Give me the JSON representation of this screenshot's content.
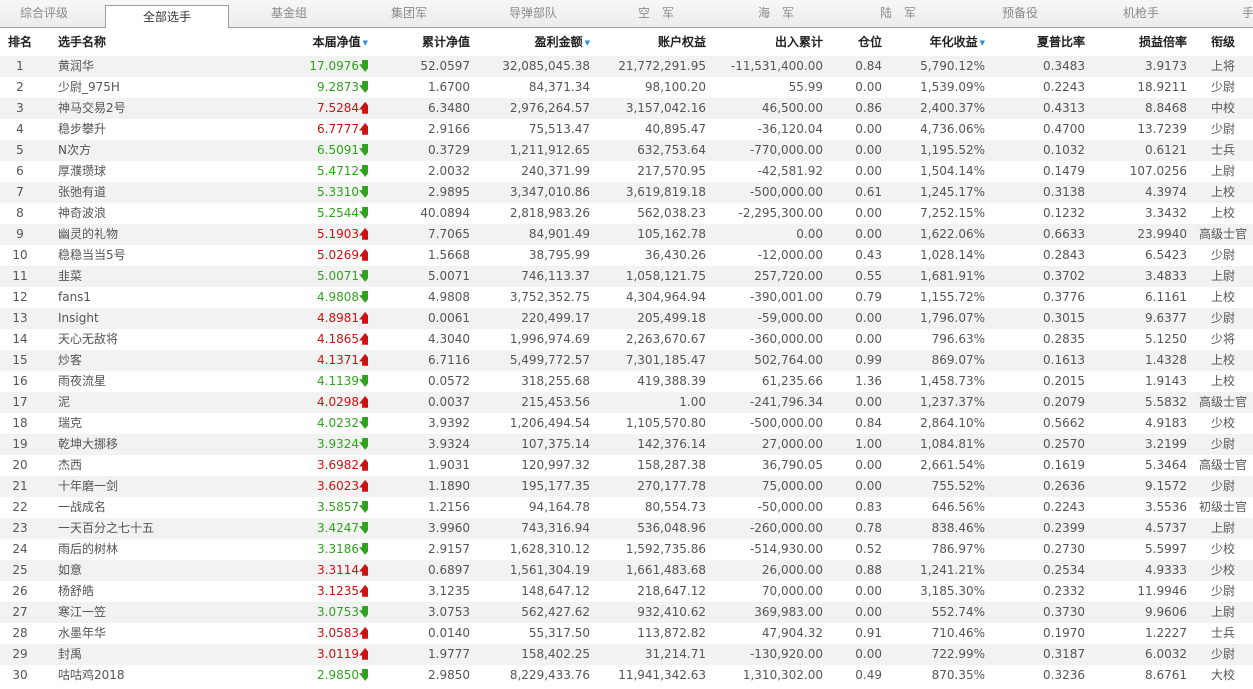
{
  "tabs": [
    {
      "label": "综合评级",
      "active": false
    },
    {
      "label": "全部选手",
      "active": true
    },
    {
      "label": "基金组",
      "active": false
    },
    {
      "label": "集团军",
      "active": false
    },
    {
      "label": "导弹部队",
      "active": false
    },
    {
      "label": "空　军",
      "active": false
    },
    {
      "label": "海　军",
      "active": false
    },
    {
      "label": "陆　军",
      "active": false
    },
    {
      "label": "预备役",
      "active": false
    },
    {
      "label": "机枪手",
      "active": false
    },
    {
      "label": "手",
      "active": false
    }
  ],
  "columns": [
    {
      "key": "rank",
      "label": "排名",
      "sorted": false
    },
    {
      "key": "name",
      "label": "选手名称",
      "sorted": false
    },
    {
      "key": "nav",
      "label": "本届净值",
      "sorted": true
    },
    {
      "key": "cum_nav",
      "label": "累计净值",
      "sorted": false
    },
    {
      "key": "profit",
      "label": "盈利金额",
      "sorted": true
    },
    {
      "key": "equity",
      "label": "账户权益",
      "sorted": false
    },
    {
      "key": "flow",
      "label": "出入累计",
      "sorted": false
    },
    {
      "key": "position",
      "label": "仓位",
      "sorted": false
    },
    {
      "key": "annual",
      "label": "年化收益",
      "sorted": true
    },
    {
      "key": "sharpe",
      "label": "夏普比率",
      "sorted": false
    },
    {
      "key": "pl_ratio",
      "label": "损益倍率",
      "sorted": false
    },
    {
      "key": "grade",
      "label": "衔级",
      "sorted": false
    }
  ],
  "rows": [
    {
      "rank": "1",
      "name": "黄润华",
      "nav": "17.0976",
      "trend": "down",
      "cum_nav": "52.0597",
      "profit": "32,085,045.38",
      "equity": "21,772,291.95",
      "flow": "-11,531,400.00",
      "position": "0.84",
      "annual": "5,790.12%",
      "sharpe": "0.3483",
      "pl_ratio": "3.9173",
      "grade": "上将"
    },
    {
      "rank": "2",
      "name": "少尉_975H",
      "nav": "9.2873",
      "trend": "down",
      "cum_nav": "1.6700",
      "profit": "84,371.34",
      "equity": "98,100.20",
      "flow": "55.99",
      "position": "0.00",
      "annual": "1,539.09%",
      "sharpe": "0.2243",
      "pl_ratio": "18.9211",
      "grade": "少尉"
    },
    {
      "rank": "3",
      "name": "神马交易2号",
      "nav": "7.5284",
      "trend": "up",
      "cum_nav": "6.3480",
      "profit": "2,976,264.57",
      "equity": "3,157,042.16",
      "flow": "46,500.00",
      "position": "0.86",
      "annual": "2,400.37%",
      "sharpe": "0.4313",
      "pl_ratio": "8.8468",
      "grade": "中校"
    },
    {
      "rank": "4",
      "name": "稳步攀升",
      "nav": "6.7777",
      "trend": "up",
      "cum_nav": "2.9166",
      "profit": "75,513.47",
      "equity": "40,895.47",
      "flow": "-36,120.04",
      "position": "0.00",
      "annual": "4,736.06%",
      "sharpe": "0.4700",
      "pl_ratio": "13.7239",
      "grade": "少尉"
    },
    {
      "rank": "5",
      "name": "N次方",
      "nav": "6.5091",
      "trend": "down",
      "cum_nav": "0.3729",
      "profit": "1,211,912.65",
      "equity": "632,753.64",
      "flow": "-770,000.00",
      "position": "0.00",
      "annual": "1,195.52%",
      "sharpe": "0.1032",
      "pl_ratio": "0.6121",
      "grade": "士兵"
    },
    {
      "rank": "6",
      "name": "厚濮瓒球",
      "nav": "5.4712",
      "trend": "down",
      "cum_nav": "2.0032",
      "profit": "240,371.99",
      "equity": "217,570.95",
      "flow": "-42,581.92",
      "position": "0.00",
      "annual": "1,504.14%",
      "sharpe": "0.1479",
      "pl_ratio": "107.0256",
      "grade": "上尉"
    },
    {
      "rank": "7",
      "name": "张弛有道",
      "nav": "5.3310",
      "trend": "down",
      "cum_nav": "2.9895",
      "profit": "3,347,010.86",
      "equity": "3,619,819.18",
      "flow": "-500,000.00",
      "position": "0.61",
      "annual": "1,245.17%",
      "sharpe": "0.3138",
      "pl_ratio": "4.3974",
      "grade": "上校"
    },
    {
      "rank": "8",
      "name": "神奇波浪",
      "nav": "5.2544",
      "trend": "down",
      "cum_nav": "40.0894",
      "profit": "2,818,983.26",
      "equity": "562,038.23",
      "flow": "-2,295,300.00",
      "position": "0.00",
      "annual": "7,252.15%",
      "sharpe": "0.1232",
      "pl_ratio": "3.3432",
      "grade": "上校"
    },
    {
      "rank": "9",
      "name": "幽灵的礼物",
      "nav": "5.1903",
      "trend": "up",
      "cum_nav": "7.7065",
      "profit": "84,901.49",
      "equity": "105,162.78",
      "flow": "0.00",
      "position": "0.00",
      "annual": "1,622.06%",
      "sharpe": "0.6633",
      "pl_ratio": "23.9940",
      "grade": "高级士官"
    },
    {
      "rank": "10",
      "name": "稳稳当当5号",
      "nav": "5.0269",
      "trend": "up",
      "cum_nav": "1.5668",
      "profit": "38,795.99",
      "equity": "36,430.26",
      "flow": "-12,000.00",
      "position": "0.43",
      "annual": "1,028.14%",
      "sharpe": "0.2843",
      "pl_ratio": "6.5423",
      "grade": "少尉"
    },
    {
      "rank": "11",
      "name": "韭菜",
      "nav": "5.0071",
      "trend": "down",
      "cum_nav": "5.0071",
      "profit": "746,113.37",
      "equity": "1,058,121.75",
      "flow": "257,720.00",
      "position": "0.55",
      "annual": "1,681.91%",
      "sharpe": "0.3702",
      "pl_ratio": "3.4833",
      "grade": "上尉"
    },
    {
      "rank": "12",
      "name": "fans1",
      "nav": "4.9808",
      "trend": "down",
      "cum_nav": "4.9808",
      "profit": "3,752,352.75",
      "equity": "4,304,964.94",
      "flow": "-390,001.00",
      "position": "0.79",
      "annual": "1,155.72%",
      "sharpe": "0.3776",
      "pl_ratio": "6.1161",
      "grade": "上校"
    },
    {
      "rank": "13",
      "name": "Insight",
      "nav": "4.8981",
      "trend": "up",
      "cum_nav": "0.0061",
      "profit": "220,499.17",
      "equity": "205,499.18",
      "flow": "-59,000.00",
      "position": "0.00",
      "annual": "1,796.07%",
      "sharpe": "0.3015",
      "pl_ratio": "9.6377",
      "grade": "少尉"
    },
    {
      "rank": "14",
      "name": "天心无敌将",
      "nav": "4.1865",
      "trend": "up",
      "cum_nav": "4.3040",
      "profit": "1,996,974.69",
      "equity": "2,263,670.67",
      "flow": "-360,000.00",
      "position": "0.00",
      "annual": "796.63%",
      "sharpe": "0.2835",
      "pl_ratio": "5.1250",
      "grade": "少将"
    },
    {
      "rank": "15",
      "name": "炒客",
      "nav": "4.1371",
      "trend": "up",
      "cum_nav": "6.7116",
      "profit": "5,499,772.57",
      "equity": "7,301,185.47",
      "flow": "502,764.00",
      "position": "0.99",
      "annual": "869.07%",
      "sharpe": "0.1613",
      "pl_ratio": "1.4328",
      "grade": "上校"
    },
    {
      "rank": "16",
      "name": "雨夜流星",
      "nav": "4.1139",
      "trend": "down",
      "cum_nav": "0.0572",
      "profit": "318,255.68",
      "equity": "419,388.39",
      "flow": "61,235.66",
      "position": "1.36",
      "annual": "1,458.73%",
      "sharpe": "0.2015",
      "pl_ratio": "1.9143",
      "grade": "上校"
    },
    {
      "rank": "17",
      "name": "泥",
      "nav": "4.0298",
      "trend": "up",
      "cum_nav": "0.0037",
      "profit": "215,453.56",
      "equity": "1.00",
      "flow": "-241,796.34",
      "position": "0.00",
      "annual": "1,237.37%",
      "sharpe": "0.2079",
      "pl_ratio": "5.5832",
      "grade": "高级士官"
    },
    {
      "rank": "18",
      "name": "瑞克",
      "nav": "4.0232",
      "trend": "down",
      "cum_nav": "3.9392",
      "profit": "1,206,494.54",
      "equity": "1,105,570.80",
      "flow": "-500,000.00",
      "position": "0.84",
      "annual": "2,864.10%",
      "sharpe": "0.5662",
      "pl_ratio": "4.9183",
      "grade": "少校"
    },
    {
      "rank": "19",
      "name": "乾坤大挪移",
      "nav": "3.9324",
      "trend": "down",
      "cum_nav": "3.9324",
      "profit": "107,375.14",
      "equity": "142,376.14",
      "flow": "27,000.00",
      "position": "1.00",
      "annual": "1,084.81%",
      "sharpe": "0.2570",
      "pl_ratio": "3.2199",
      "grade": "少尉"
    },
    {
      "rank": "20",
      "name": "杰西",
      "nav": "3.6982",
      "trend": "up",
      "cum_nav": "1.9031",
      "profit": "120,997.32",
      "equity": "158,287.38",
      "flow": "36,790.05",
      "position": "0.00",
      "annual": "2,661.54%",
      "sharpe": "0.1619",
      "pl_ratio": "5.3464",
      "grade": "高级士官"
    },
    {
      "rank": "21",
      "name": "十年磨一剑",
      "nav": "3.6023",
      "trend": "up",
      "cum_nav": "1.1890",
      "profit": "195,177.35",
      "equity": "270,177.78",
      "flow": "75,000.00",
      "position": "0.00",
      "annual": "755.52%",
      "sharpe": "0.2636",
      "pl_ratio": "9.1572",
      "grade": "少尉"
    },
    {
      "rank": "22",
      "name": "一战成名",
      "nav": "3.5857",
      "trend": "down",
      "cum_nav": "1.2156",
      "profit": "94,164.78",
      "equity": "80,554.73",
      "flow": "-50,000.00",
      "position": "0.83",
      "annual": "646.56%",
      "sharpe": "0.2243",
      "pl_ratio": "3.5536",
      "grade": "初级士官"
    },
    {
      "rank": "23",
      "name": "一天百分之七十五",
      "nav": "3.4247",
      "trend": "down",
      "cum_nav": "3.9960",
      "profit": "743,316.94",
      "equity": "536,048.96",
      "flow": "-260,000.00",
      "position": "0.78",
      "annual": "838.46%",
      "sharpe": "0.2399",
      "pl_ratio": "4.5737",
      "grade": "上尉"
    },
    {
      "rank": "24",
      "name": "雨后的树林",
      "nav": "3.3186",
      "trend": "down",
      "cum_nav": "2.9157",
      "profit": "1,628,310.12",
      "equity": "1,592,735.86",
      "flow": "-514,930.00",
      "position": "0.52",
      "annual": "786.97%",
      "sharpe": "0.2730",
      "pl_ratio": "5.5997",
      "grade": "少校"
    },
    {
      "rank": "25",
      "name": "如意",
      "nav": "3.3114",
      "trend": "up",
      "cum_nav": "0.6897",
      "profit": "1,561,304.19",
      "equity": "1,661,483.68",
      "flow": "26,000.00",
      "position": "0.88",
      "annual": "1,241.21%",
      "sharpe": "0.2534",
      "pl_ratio": "4.9333",
      "grade": "少校"
    },
    {
      "rank": "26",
      "name": "杨舒皓",
      "nav": "3.1235",
      "trend": "up",
      "cum_nav": "3.1235",
      "profit": "148,647.12",
      "equity": "218,647.12",
      "flow": "70,000.00",
      "position": "0.00",
      "annual": "3,185.30%",
      "sharpe": "0.2332",
      "pl_ratio": "11.9946",
      "grade": "少尉"
    },
    {
      "rank": "27",
      "name": "寒江一笠",
      "nav": "3.0753",
      "trend": "down",
      "cum_nav": "3.0753",
      "profit": "562,427.62",
      "equity": "932,410.62",
      "flow": "369,983.00",
      "position": "0.00",
      "annual": "552.74%",
      "sharpe": "0.3730",
      "pl_ratio": "9.9606",
      "grade": "上尉"
    },
    {
      "rank": "28",
      "name": "水墨年华",
      "nav": "3.0583",
      "trend": "up",
      "cum_nav": "0.0140",
      "profit": "55,317.50",
      "equity": "113,872.82",
      "flow": "47,904.32",
      "position": "0.91",
      "annual": "710.46%",
      "sharpe": "0.1970",
      "pl_ratio": "1.2227",
      "grade": "士兵"
    },
    {
      "rank": "29",
      "name": "封禹",
      "nav": "3.0119",
      "trend": "up",
      "cum_nav": "1.9777",
      "profit": "158,402.25",
      "equity": "31,214.71",
      "flow": "-130,920.00",
      "position": "0.00",
      "annual": "722.99%",
      "sharpe": "0.3187",
      "pl_ratio": "6.0032",
      "grade": "少尉"
    },
    {
      "rank": "30",
      "name": "咕咕鸡2018",
      "nav": "2.9850",
      "trend": "down",
      "cum_nav": "2.9850",
      "profit": "8,229,433.76",
      "equity": "11,941,342.63",
      "flow": "1,310,302.00",
      "position": "0.49",
      "annual": "870.35%",
      "sharpe": "0.3236",
      "pl_ratio": "8.6761",
      "grade": "大校"
    }
  ],
  "symbols": {
    "up": "🡅",
    "down": "🡇",
    "sort": "▼"
  },
  "colors": {
    "up": "#cc1111",
    "down": "#2fa31e",
    "row_alt": "#f2f2f2",
    "sort_icon": "#2a8fd6"
  }
}
